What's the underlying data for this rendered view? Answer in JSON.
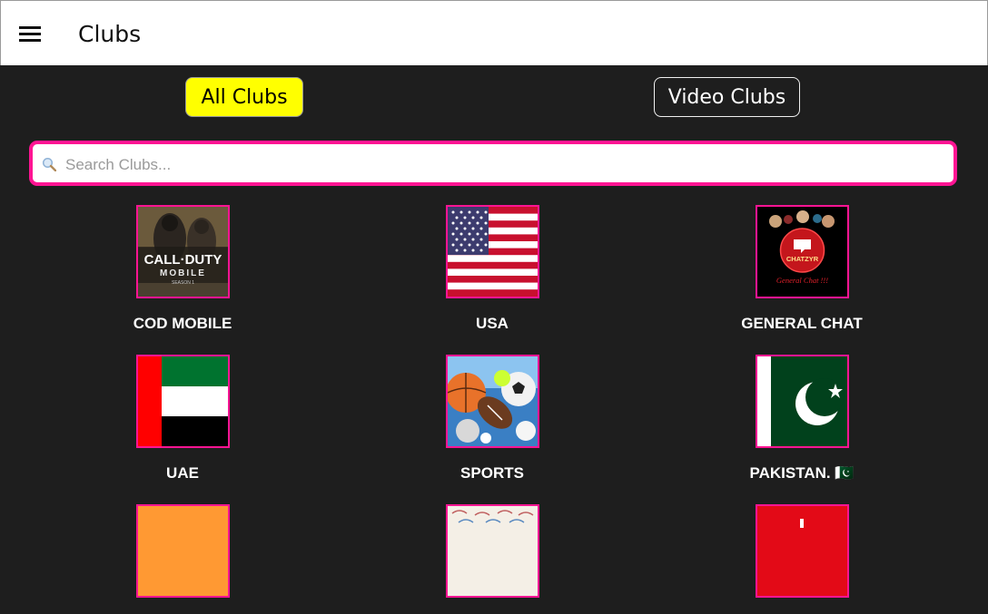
{
  "header": {
    "title": "Clubs",
    "menu_icon": "hamburger-menu-icon"
  },
  "tabs": {
    "all_clubs": "All Clubs",
    "video_clubs": "Video Clubs",
    "active": "All Clubs"
  },
  "search": {
    "placeholder": "Search Clubs...",
    "value": "",
    "icon": "magnifier-icon"
  },
  "clubs": [
    {
      "label": "COD MOBILE",
      "icon": "cod-mobile-thumbnail",
      "logo_text": [
        "CALL·DUTY",
        "MOBILE",
        "SEASON 1"
      ]
    },
    {
      "label": "USA",
      "icon": "usa-flag"
    },
    {
      "label": "GENERAL CHAT",
      "icon": "general-chat-thumbnail",
      "logo_text": [
        "CHATZYR",
        "General Chat !!!"
      ]
    },
    {
      "label": "UAE",
      "icon": "uae-flag"
    },
    {
      "label": "SPORTS",
      "icon": "sports-balls-thumbnail"
    },
    {
      "label": "PAKISTAN. 🇵🇰",
      "icon": "pakistan-flag"
    },
    {
      "label": "",
      "icon": "orange-thumbnail"
    },
    {
      "label": "",
      "icon": "pattern-thumbnail"
    },
    {
      "label": "",
      "icon": "red-thumbnail"
    }
  ],
  "colors": {
    "accent": "#ff1493",
    "active_tab": "#ffff00",
    "background": "#1e1e1e"
  }
}
